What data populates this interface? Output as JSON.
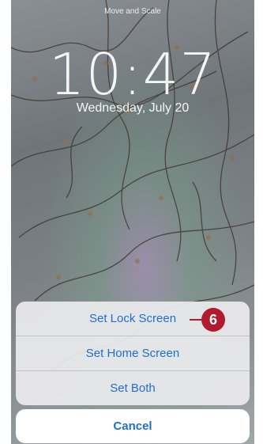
{
  "lock_screen": {
    "caption": "Move and Scale",
    "time": "10:47",
    "date": "Wednesday, July 20"
  },
  "action_sheet": {
    "options": [
      {
        "label": "Set Lock Screen"
      },
      {
        "label": "Set Home Screen"
      },
      {
        "label": "Set Both"
      }
    ],
    "cancel_label": "Cancel"
  },
  "callout": {
    "number": "6",
    "color": "#b01c2e"
  },
  "colors": {
    "action_text": "#1f6fd1"
  }
}
